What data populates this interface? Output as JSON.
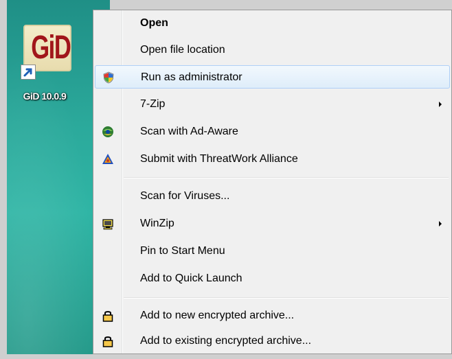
{
  "desktop": {
    "shortcut": {
      "icon_letters": "GiD",
      "label": "GiD 10.0.9"
    }
  },
  "context_menu": {
    "items": [
      {
        "label": "Open",
        "bold": true
      },
      {
        "label": "Open file location"
      },
      {
        "label": "Run as administrator",
        "icon": "uac-shield-icon",
        "highlighted": true
      },
      {
        "label": "7-Zip",
        "submenu": true
      },
      {
        "label": "Scan with Ad-Aware",
        "icon": "ad-aware-icon"
      },
      {
        "label": "Submit with ThreatWork Alliance",
        "icon": "threatwork-icon"
      },
      {
        "label": "Scan for Viruses..."
      },
      {
        "label": "WinZip",
        "icon": "winzip-icon",
        "submenu": true
      },
      {
        "label": "Pin to Start Menu"
      },
      {
        "label": "Add to Quick Launch"
      },
      {
        "label": "Add to new encrypted archive...",
        "icon": "lock-icon"
      },
      {
        "label": "Add to existing encrypted archive...",
        "icon": "lock-icon"
      }
    ]
  }
}
